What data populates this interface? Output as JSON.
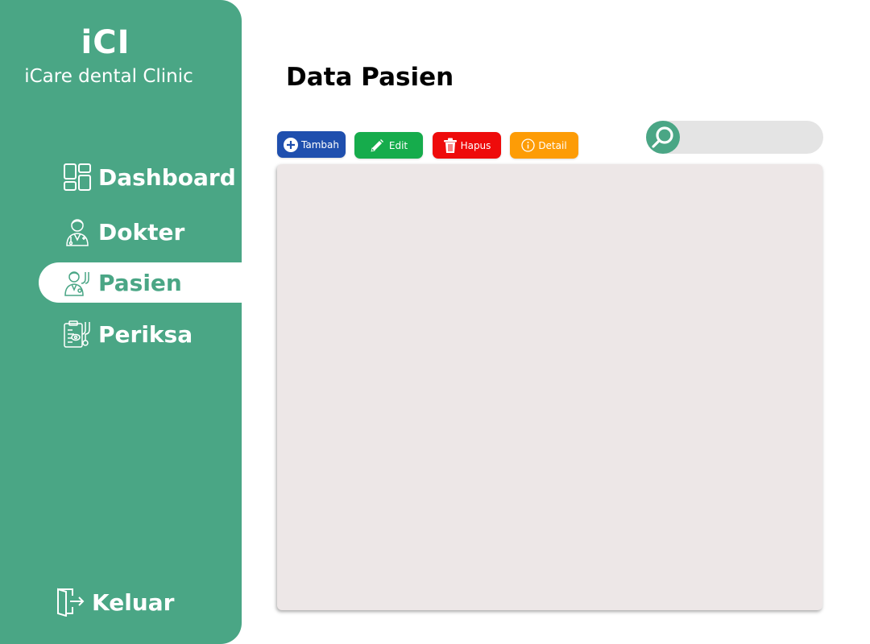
{
  "brand": {
    "logo_text": "iCI",
    "subtitle": "iCare dental Clinic"
  },
  "sidebar": {
    "items": [
      {
        "label": "Dashboard",
        "icon": "dashboard-icon",
        "active": false
      },
      {
        "label": "Dokter",
        "icon": "doctor-icon",
        "active": false
      },
      {
        "label": "Pasien",
        "icon": "patient-icon",
        "active": true
      },
      {
        "label": "Periksa",
        "icon": "checkup-icon",
        "active": false
      }
    ],
    "logout_label": "Keluar"
  },
  "main": {
    "title": "Data Pasien",
    "toolbar": {
      "add_label": "Tambah",
      "edit_label": "Edit",
      "delete_label": "Hapus",
      "detail_label": "Detail"
    },
    "search": {
      "placeholder": "",
      "value": ""
    }
  },
  "colors": {
    "primary": "#4aa685",
    "add": "#1f4fae",
    "edit": "#16ac4c",
    "delete": "#ee0b0b",
    "detail": "#fd9c06",
    "panel": "#ede7e7",
    "search_bg": "#e4e4e4"
  }
}
